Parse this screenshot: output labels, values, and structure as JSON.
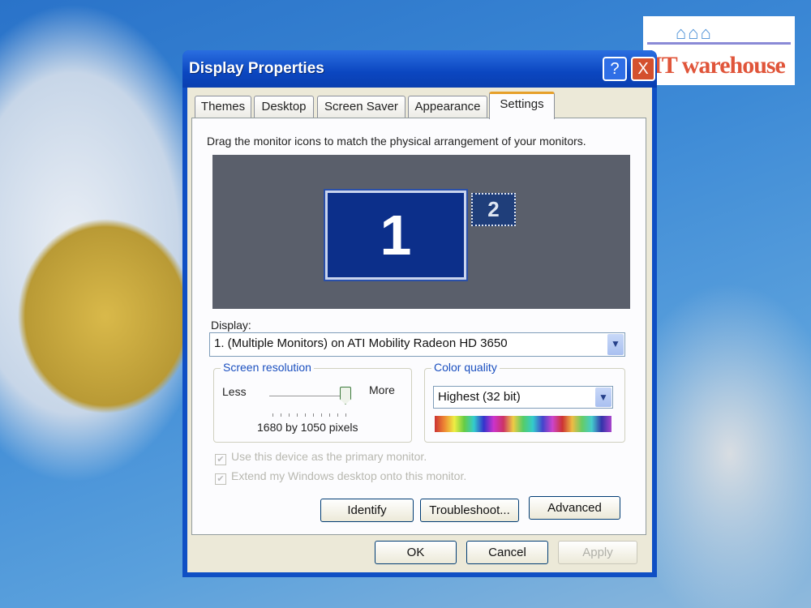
{
  "watermark": {
    "brand": "IT warehouse"
  },
  "window": {
    "title": "Display Properties",
    "help_label": "?",
    "close_label": "X"
  },
  "tabs": [
    {
      "label": "Themes",
      "active": false
    },
    {
      "label": "Desktop",
      "active": false
    },
    {
      "label": "Screen Saver",
      "active": false
    },
    {
      "label": "Appearance",
      "active": false
    },
    {
      "label": "Settings",
      "active": true
    }
  ],
  "settings": {
    "instruction": "Drag the monitor icons to match the physical arrangement of your monitors.",
    "monitors": [
      {
        "label": "1",
        "selected": true
      },
      {
        "label": "2",
        "selected": false
      }
    ],
    "display_label": "Display:",
    "display_value": "1. (Multiple Monitors) on ATI Mobility Radeon HD 3650",
    "resolution": {
      "group_label": "Screen resolution",
      "less": "Less",
      "more": "More",
      "value": "1680 by 1050 pixels",
      "slider_percent": 100
    },
    "color": {
      "group_label": "Color quality",
      "value": "Highest (32 bit)"
    },
    "checkboxes": [
      {
        "label": "Use this device as the primary monitor.",
        "checked": true,
        "disabled": true
      },
      {
        "label": "Extend my Windows desktop onto this monitor.",
        "checked": true,
        "disabled": true
      }
    ],
    "buttons": {
      "identify": "Identify",
      "troubleshoot": "Troubleshoot...",
      "advanced": "Advanced"
    }
  },
  "footer": {
    "ok": "OK",
    "cancel": "Cancel",
    "apply": "Apply"
  },
  "colors": {
    "titlebar": "#0b46c0",
    "dialog_bg": "#ece9d8",
    "active_tab_accent": "#e6a02a",
    "group_label": "#1a4fbf"
  }
}
